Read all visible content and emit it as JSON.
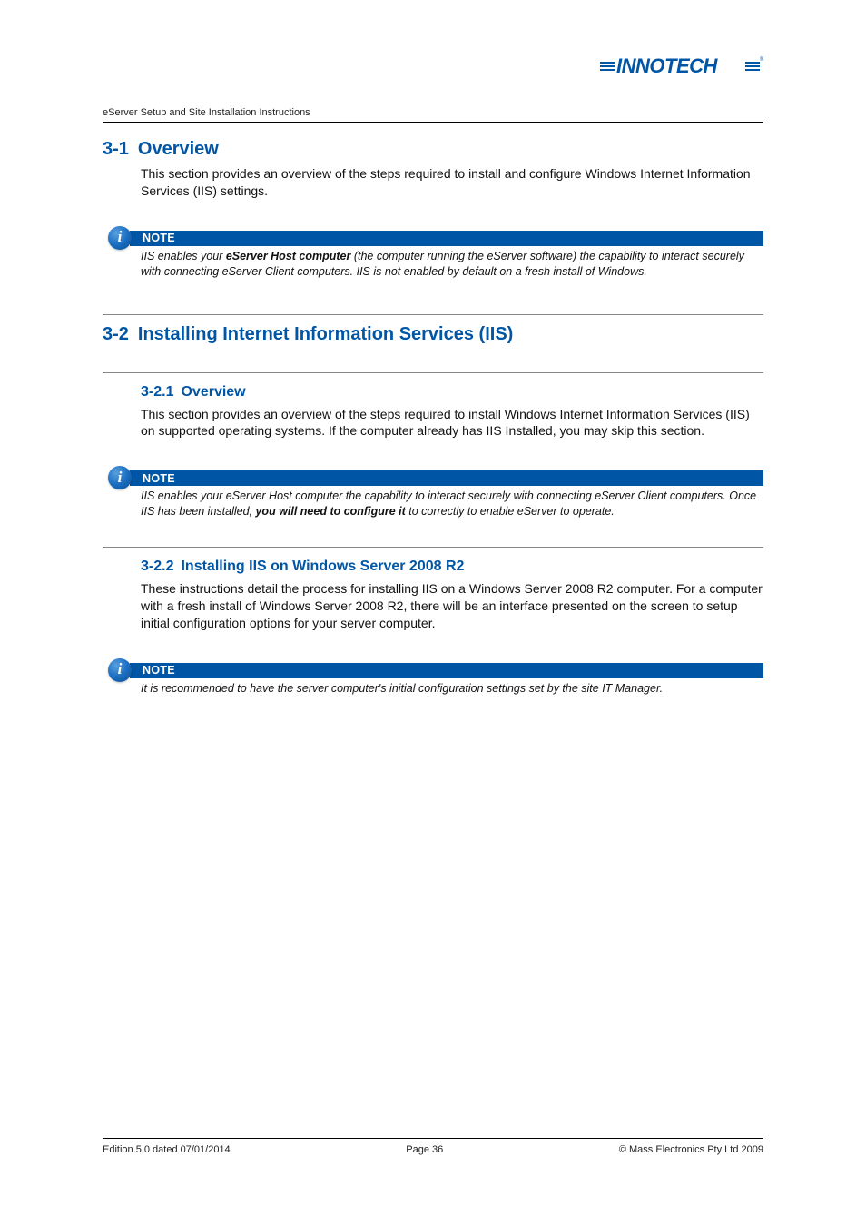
{
  "brand": "INNOTECH",
  "doc_title": "eServer Setup and Site Installation Instructions",
  "s31": {
    "num": "3-1",
    "title": "Overview",
    "body": "This section provides an overview of the steps required to install and configure Windows Internet Information Services (IIS) settings."
  },
  "note1": {
    "label": "NOTE",
    "pre": "IIS enables your ",
    "bold": "eServer Host computer",
    "post": " (the computer running the eServer software) the capability to interact securely with connecting eServer Client computers.  IIS is not enabled by default on a fresh install of Windows."
  },
  "s32": {
    "num": "3-2",
    "title": "Installing Internet Information Services (IIS)"
  },
  "s321": {
    "num": "3-2.1",
    "title": "Overview",
    "body": "This section provides an overview of the steps required to install Windows Internet Information Services (IIS) on supported operating systems.  If the computer already has IIS Installed, you may skip this section."
  },
  "note2": {
    "label": "NOTE",
    "pre": "IIS enables your eServer Host computer the capability to interact securely with connecting eServer Client computers.  Once IIS has been installed, ",
    "bold": "you will need to configure it",
    "post": " to correctly to enable eServer to operate."
  },
  "s322": {
    "num": "3-2.2",
    "title": "Installing IIS on Windows Server 2008 R2",
    "body": "These instructions detail the process for installing IIS on a Windows Server 2008 R2 computer.  For a computer with a fresh install of Windows Server 2008 R2, there will be an interface presented on the screen to setup initial configuration options for your server computer."
  },
  "note3": {
    "label": "NOTE",
    "body": "It is recommended to have the server computer's initial configuration settings set by the site IT Manager."
  },
  "footer": {
    "left": "Edition 5.0 dated 07/01/2014",
    "center": "Page 36",
    "right": "©  Mass Electronics Pty Ltd  2009"
  },
  "icon": {
    "glyph": "i"
  }
}
